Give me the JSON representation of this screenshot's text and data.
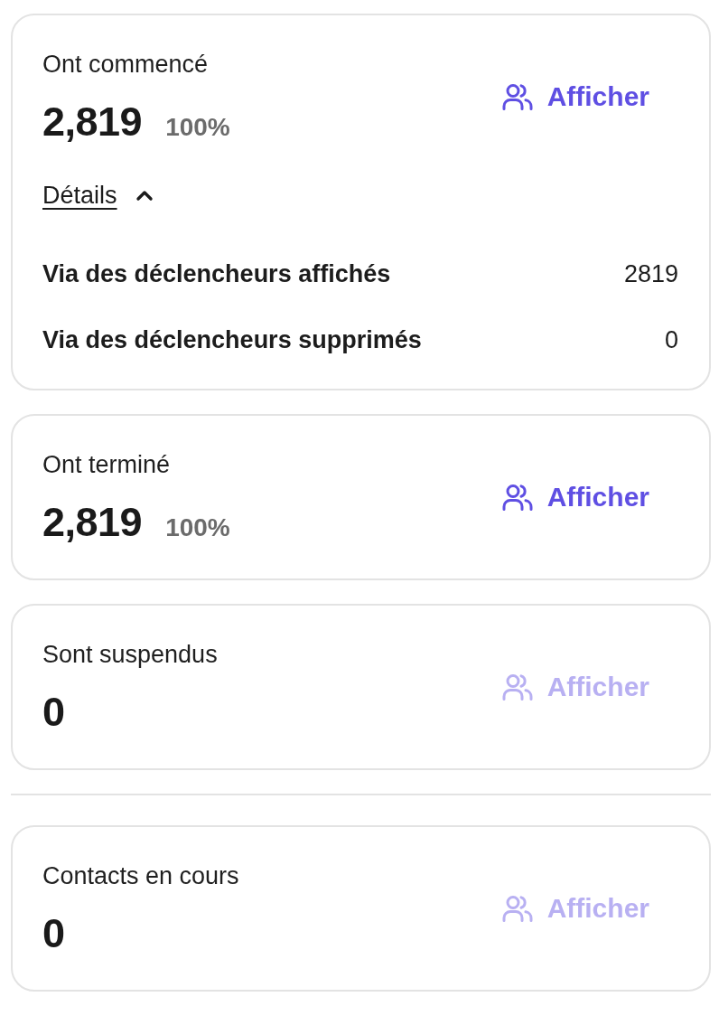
{
  "sections": [
    {
      "cards": [
        {
          "title": "Ont commencé",
          "value": "2,819",
          "percent": "100%",
          "action": {
            "label": "Afficher",
            "disabled": false
          },
          "details": {
            "label": "Détails",
            "expanded": true,
            "rows": [
              {
                "label": "Via des déclencheurs affichés",
                "value": "2819"
              },
              {
                "label": "Via des déclencheurs supprimés",
                "value": "0"
              }
            ]
          }
        },
        {
          "title": "Ont terminé",
          "value": "2,819",
          "percent": "100%",
          "action": {
            "label": "Afficher",
            "disabled": false
          }
        },
        {
          "title": "Sont suspendus",
          "value": "0",
          "action": {
            "label": "Afficher",
            "disabled": true
          }
        }
      ]
    },
    {
      "cards": [
        {
          "title": "Contacts en cours",
          "value": "0",
          "action": {
            "label": "Afficher",
            "disabled": true
          }
        }
      ]
    }
  ]
}
